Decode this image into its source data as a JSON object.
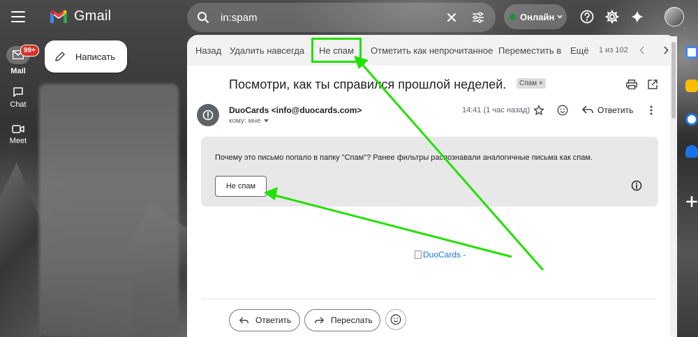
{
  "app": {
    "name": "Gmail"
  },
  "rail": {
    "mail_label": "Mail",
    "mail_badge": "99+",
    "chat_label": "Chat",
    "meet_label": "Meet"
  },
  "compose": {
    "label": "Написать"
  },
  "search": {
    "query": "in:spam"
  },
  "status": {
    "label": "Онлайн",
    "color": "#1e8e3e"
  },
  "toolbar": {
    "back": "Назад",
    "delete_forever": "Удалить навсегда",
    "not_spam": "Не спам",
    "mark_unread": "Отметить как непрочитанное",
    "move_to": "Переместить в",
    "more": "Ещё",
    "counter": "1 из 102"
  },
  "message": {
    "subject": "Посмотри, как ты справился прошлой неделей.",
    "label_chip": "Спам",
    "sender": "DuoCards <info@duocards.com>",
    "to": "кому: мне",
    "time": "14:41 (1 час назад)",
    "reply_label": "Ответить",
    "body_image_alt": "DuoCards -"
  },
  "spam_notice": {
    "text": "Почему это письмо попало в папку \"Спам\"? Ранее фильтры распознавали аналогичные письма как спам.",
    "button": "Не спам"
  },
  "footer": {
    "reply": "Ответить",
    "forward": "Переслать"
  },
  "colors": {
    "annotation": "#22e000",
    "accent_link": "#1a73e8",
    "badge": "#d93025"
  }
}
